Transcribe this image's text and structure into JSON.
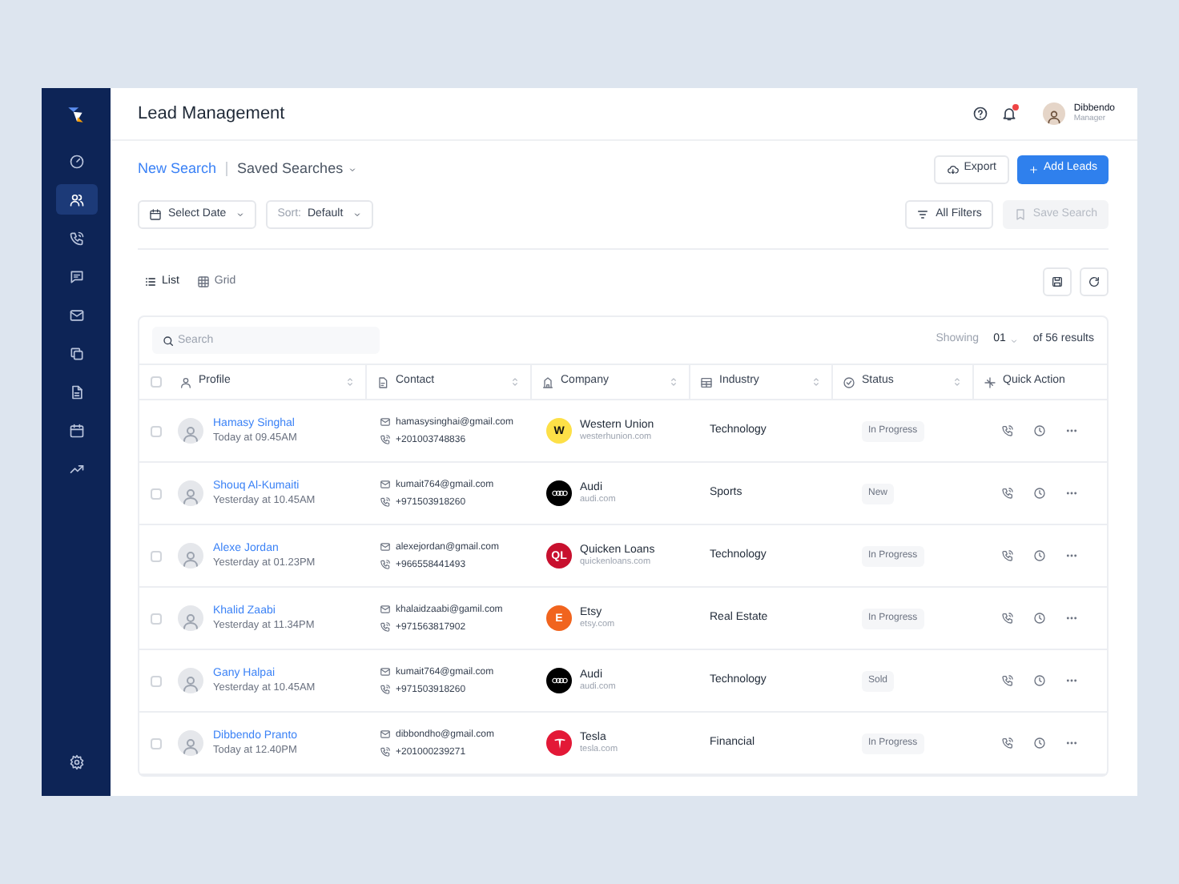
{
  "header": {
    "title": "Lead Management",
    "notifications_unread": true,
    "user": {
      "name": "Dibbendo",
      "role": "Manager"
    }
  },
  "sidebar": {
    "items": [
      {
        "selected": false
      },
      {
        "selected": true
      },
      {
        "selected": false
      },
      {
        "selected": false
      },
      {
        "selected": false
      },
      {
        "selected": false
      },
      {
        "selected": false
      },
      {
        "selected": false
      },
      {
        "selected": false
      }
    ]
  },
  "search_tabs": [
    {
      "label": "New Search",
      "selected": true
    },
    {
      "label": "Saved Searches",
      "selected": false
    }
  ],
  "actions": [
    {
      "label": "Export",
      "kind": "outline"
    },
    {
      "label": "Add Leads",
      "kind": "primary"
    }
  ],
  "filters": [
    {
      "kind": "date",
      "label": "Select Date"
    },
    {
      "kind": "sort",
      "prefix": "Sort:",
      "label": "Default"
    }
  ],
  "filter_actions": [
    {
      "label": "All Filters",
      "disabled": false
    },
    {
      "label": "Save Search",
      "disabled": true
    }
  ],
  "views": [
    {
      "label": "List",
      "selected": true
    },
    {
      "label": "Grid",
      "selected": false
    }
  ],
  "table": {
    "select_all": {
      "checked": false
    },
    "search": {
      "placeholder": "Search"
    },
    "showing": {
      "label": "Showing",
      "page": "01",
      "total": "of 56 results"
    },
    "columns": [
      {
        "label": "Profile",
        "sortable": true
      },
      {
        "label": "Contact",
        "sortable": true
      },
      {
        "label": "Company",
        "sortable": true
      },
      {
        "label": "Industry",
        "sortable": true
      },
      {
        "label": "Status",
        "sortable": true
      },
      {
        "label": "Quick Action",
        "sortable": false
      }
    ],
    "rows": [
      {
        "checked": false,
        "name": "Hamasy Singhal",
        "time": "Today at 09.45AM",
        "email": "hamasysinghai@gmail.com",
        "phone": "+201003748836",
        "company": {
          "name": "Western Union",
          "domain": "westerhunion.com",
          "logo": {
            "kind": "letter",
            "text": "W",
            "color": "#fde047"
          }
        },
        "industry": "Technology",
        "status": "In Progress"
      },
      {
        "checked": false,
        "name": "Shouq Al-Kumaiti",
        "time": "Yesterday at 10.45AM",
        "email": "kumait764@gmail.com",
        "phone": "+971503918260",
        "company": {
          "name": "Audi",
          "domain": "audi.com",
          "logo": {
            "kind": "rings",
            "color": "#000000"
          }
        },
        "industry": "Sports",
        "status": "New"
      },
      {
        "checked": false,
        "name": "Alexe Jordan",
        "time": "Yesterday at 01.23PM",
        "email": "alexejordan@gmail.com",
        "phone": "+966558441493",
        "company": {
          "name": "Quicken Loans",
          "domain": "quickenloans.com",
          "logo": {
            "kind": "letter",
            "text": "QL",
            "color": "#c8102e"
          }
        },
        "industry": "Technology",
        "status": "In Progress"
      },
      {
        "checked": false,
        "name": "Khalid Zaabi",
        "time": "Yesterday at 11.34PM",
        "email": "khalaidzaabi@gamil.com",
        "phone": "+971563817902",
        "company": {
          "name": "Etsy",
          "domain": "etsy.com",
          "logo": {
            "kind": "letter",
            "text": "E",
            "color": "#f1641e"
          }
        },
        "industry": "Real Estate",
        "status": "In Progress"
      },
      {
        "checked": false,
        "name": "Gany Halpai",
        "time": "Yesterday at 10.45AM",
        "email": "kumait764@gmail.com",
        "phone": "+971503918260",
        "company": {
          "name": "Audi",
          "domain": "audi.com",
          "logo": {
            "kind": "rings",
            "color": "#000000"
          }
        },
        "industry": "Technology",
        "status": "Sold"
      },
      {
        "checked": false,
        "name": "Dibbendo Pranto",
        "time": "Today at 12.40PM",
        "email": "dibbondho@gmail.com",
        "phone": "+201000239271",
        "company": {
          "name": "Tesla",
          "domain": "tesla.com",
          "logo": {
            "kind": "tesla",
            "color": "#e31937"
          }
        },
        "industry": "Financial",
        "status": "In Progress"
      }
    ]
  }
}
